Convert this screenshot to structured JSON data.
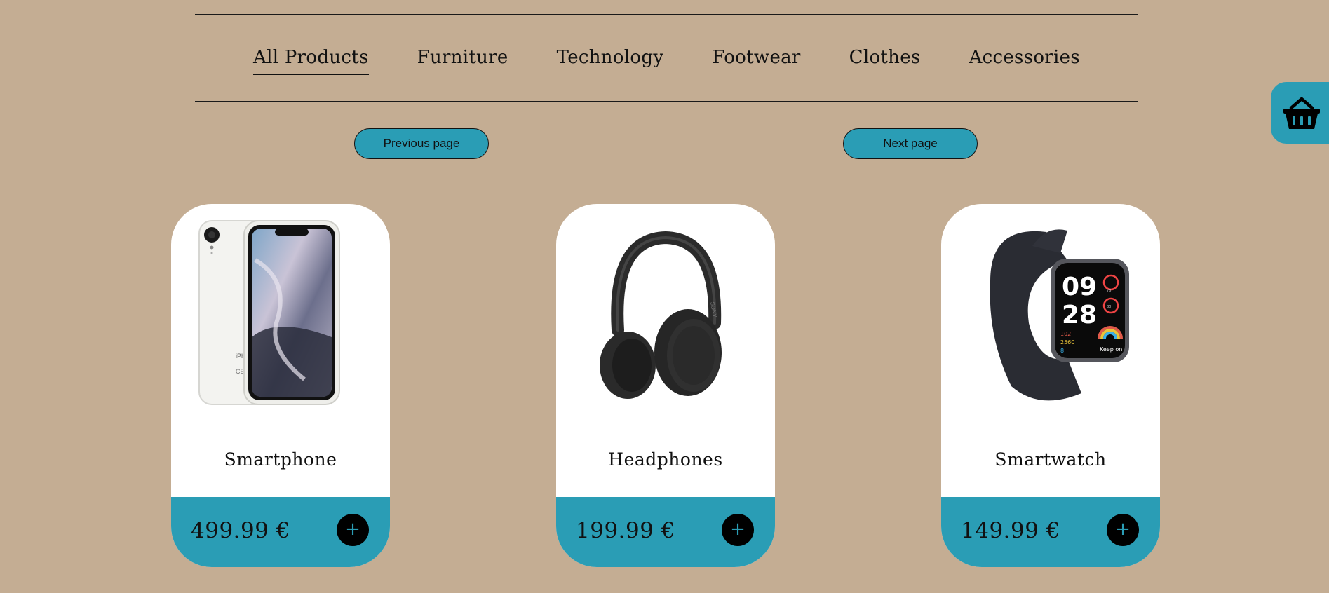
{
  "nav": {
    "items": [
      {
        "label": "All Products",
        "active": true
      },
      {
        "label": "Furniture",
        "active": false
      },
      {
        "label": "Technology",
        "active": false
      },
      {
        "label": "Footwear",
        "active": false
      },
      {
        "label": "Clothes",
        "active": false
      },
      {
        "label": "Accessories",
        "active": false
      }
    ]
  },
  "pagination": {
    "previous_label": "Previous page",
    "next_label": "Next page"
  },
  "cart": {
    "icon": "basket-icon"
  },
  "products": [
    {
      "name": "Smartphone",
      "price": "499.99 €",
      "add_label": "+",
      "image": "smartphone-image"
    },
    {
      "name": "Headphones",
      "price": "199.99 €",
      "add_label": "+",
      "image": "headphones-image"
    },
    {
      "name": "Smartwatch",
      "price": "149.99 €",
      "add_label": "+",
      "image": "smartwatch-image"
    }
  ],
  "watch_face": {
    "hour": "09",
    "minute": "28",
    "stat1": "102",
    "stat2": "2560",
    "stat3": "8",
    "motto": "Keep on",
    "hr": "78",
    "o2": "80"
  },
  "colors": {
    "background": "#c4ad93",
    "accent": "#2a9db5",
    "card": "#ffffff",
    "text": "#111111"
  }
}
